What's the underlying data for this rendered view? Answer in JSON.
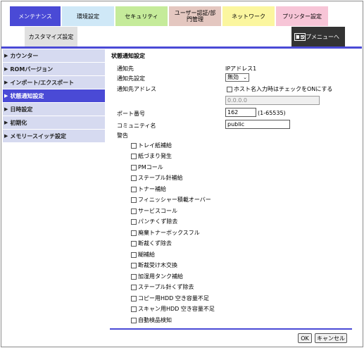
{
  "tabs": [
    {
      "label": "メンテナンス",
      "color": "#4a4ad6",
      "active": true
    },
    {
      "label": "環境設定",
      "color": "#cfe8f7"
    },
    {
      "label": "セキュリティ",
      "color": "#c5eb9a"
    },
    {
      "label": "ユーザー認証/部門管理",
      "color": "#e4c7c0"
    },
    {
      "label": "ネットワーク",
      "color": "#fbf69f"
    },
    {
      "label": "プリンター設定",
      "color": "#f7c5d7"
    }
  ],
  "subtab_label": "カスタマイズ設定",
  "topmenu_label": "トップメニューへ",
  "sidebar": {
    "items": [
      {
        "label": "カウンター"
      },
      {
        "label": "ROMバージョン"
      },
      {
        "label": "インポート/エクスポート"
      },
      {
        "label": "状態通知設定",
        "active": true
      },
      {
        "label": "日時設定"
      },
      {
        "label": "初期化"
      },
      {
        "label": "メモリースイッチ設定"
      }
    ]
  },
  "form": {
    "section_title": "状態通知設定",
    "notify_dest_label": "通知先",
    "notify_dest_value": "IPアドレス1",
    "notify_setting_label": "通知先設定",
    "notify_setting_value": "無効",
    "notify_address_label": "通知先アドレス",
    "host_checkbox_label": "ホスト名入力時はチェックをONにする",
    "address_value": "0.0.0.0",
    "port_label": "ポート番号",
    "port_value": "162",
    "port_range": "(1-65535)",
    "community_label": "コミュニティ名",
    "community_value": "public",
    "warning_label": "警告",
    "warnings": [
      "トレイ紙補給",
      "紙づまり発生",
      "PMコール",
      "ステープル針補給",
      "トナー補給",
      "フィニッシャー積載オーバー",
      "サービスコール",
      "パンチくず除去",
      "廃棄トナーボックスフル",
      "断裁くず除去",
      "糊補給",
      "断裁受け木交換",
      "加湿用タンク補給",
      "ステープル針くず除去",
      "コピー用HDD 空き容量不足",
      "スキャン用HDD 空き容量不足",
      "自動検品検知"
    ]
  },
  "buttons": {
    "ok": "OK",
    "cancel": "キャンセル"
  }
}
